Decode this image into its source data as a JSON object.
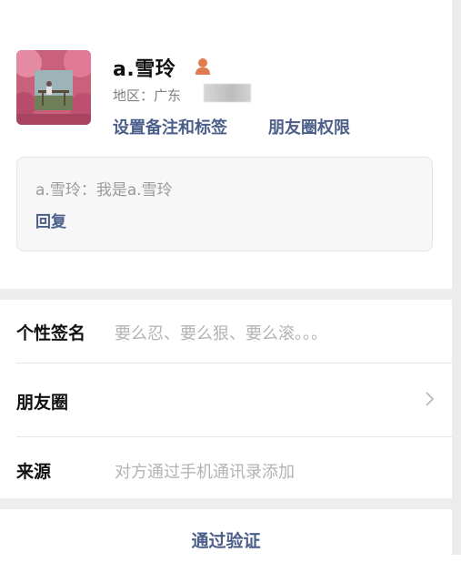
{
  "profile": {
    "name": "a.雪玲",
    "region_label": "地区：广东",
    "avatar": "profile-photo",
    "gender_icon": "person-icon",
    "links": {
      "set_remark": "设置备注和标签",
      "moments_permission": "朋友圈权限"
    }
  },
  "request_message": {
    "text": "a.雪玲：我是a.雪玲",
    "reply": "回复"
  },
  "details": {
    "signature": {
      "label": "个性签名",
      "value": "要么忍、要么狠、要么滚。。。"
    },
    "moments": {
      "label": "朋友圈",
      "icon": "chevron-right-icon"
    },
    "source": {
      "label": "来源",
      "value": "对方通过手机通讯录添加"
    }
  },
  "actions": {
    "verify": "通过验证"
  },
  "colors": {
    "link": "#4c5f8a",
    "gender_icon": "#e07b4f",
    "secondary_text": "#b3b3b3",
    "section_gap": "#ededed"
  }
}
